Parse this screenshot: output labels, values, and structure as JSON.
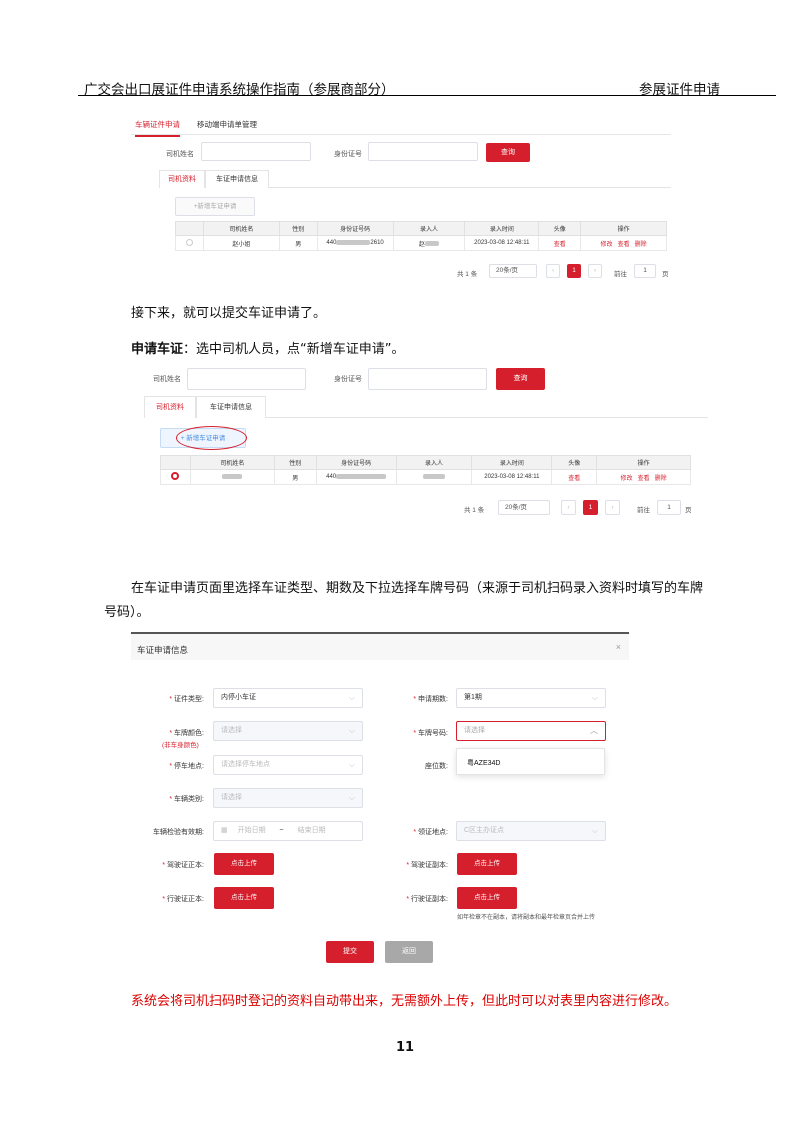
{
  "header": {
    "left": "广交会出口展证件申请系统操作指南（参展商部分）",
    "right": "参展证件申请"
  },
  "shot1": {
    "tabs": [
      "车辆证件申请",
      "移动端申请单管理"
    ],
    "driver_name_label": "司机姓名",
    "id_label": "身份证号",
    "query": "查询",
    "subtabs": [
      "司机资料",
      "车证申请信息"
    ],
    "new_button": "+新增车证申请",
    "columns": [
      "",
      "司机姓名",
      "性别",
      "身份证号码",
      "录入人",
      "录入时间",
      "头像",
      "操作"
    ],
    "row": {
      "name": "赵小姐",
      "gender": "男",
      "id_prefix": "440",
      "id_suffix": "2610",
      "entered_by": "赵",
      "time": "2023-03-08 12:48:11",
      "avatar": "查看",
      "edit": "修改",
      "view": "查看",
      "delete": "删除"
    },
    "pager": {
      "total": "共 1 条",
      "size": "20条/页",
      "prev": "‹",
      "page": "1",
      "next": "›",
      "goto": "前往",
      "goto_value": "1",
      "page_unit": "页"
    }
  },
  "para1": "接下来，就可以提交车证申请了。",
  "para2_bold": "申请车证",
  "para2_rest": "：选中司机人员，点“新增车证申请”。",
  "shot2": {
    "driver_name_label": "司机姓名",
    "id_label": "身份证号",
    "query": "查询",
    "subtabs": [
      "司机资料",
      "车证申请信息"
    ],
    "new_button": "+ 新增车证申请",
    "columns": [
      "",
      "司机姓名",
      "性别",
      "身份证号码",
      "录入人",
      "录入时间",
      "头像",
      "操作"
    ],
    "row": {
      "gender": "男",
      "id_prefix": "440",
      "time": "2023-03-08 12:48:11",
      "avatar": "查看",
      "edit": "修改",
      "view": "查看",
      "delete": "删除"
    },
    "pager": {
      "total": "共 1 条",
      "size": "20条/页",
      "prev": "‹",
      "page": "1",
      "next": "›",
      "goto": "前往",
      "goto_value": "1",
      "page_unit": "页"
    }
  },
  "para3_line1": "在车证申请页面里选择车证类型、期数及下拉选择车牌号码（来源于司机扫码录入资料时填写的车牌",
  "para3_line2": "号码）。",
  "dialog": {
    "title": "车证申请信息",
    "close": "×",
    "fields": {
      "cert_type_label": "证件类型:",
      "cert_type_value": "内停小车证",
      "period_label": "申请期数:",
      "period_value": "第1期",
      "plate_color_label": "车牌颜色:",
      "plate_color_value": "请选择",
      "plate_color_note": "(非车身颜色)",
      "plate_no_label": "车牌号码:",
      "plate_no_value": "请选择",
      "parking_label": "停车地点:",
      "parking_value": "请选择停车地点",
      "seats_label": "座位数:",
      "vehicle_type_label": "车辆类别:",
      "vehicle_type_value": "请选择",
      "inspection_label": "车辆检验有效期:",
      "start_date": "开始日期",
      "tilde": "~",
      "end_date": "结束日期",
      "pickup_label": "领证地点:",
      "pickup_value": "C区主办证点",
      "license_front_label": "驾驶证正本:",
      "license_back_label": "驾驶证副本:",
      "reg_front_label": "行驶证正本:",
      "reg_back_label": "行驶证副本:",
      "upload": "点击上传",
      "upload_note": "如年检章不在副本，请将副本和最年检章页合并上传"
    },
    "dropdown_option": "粤AZE34D",
    "submit": "提交",
    "back": "返回"
  },
  "para4": "系统会将司机扫码时登记的资料自动带出来，无需额外上传，但此时可以对表里内容进行修改。",
  "page_number": "11"
}
